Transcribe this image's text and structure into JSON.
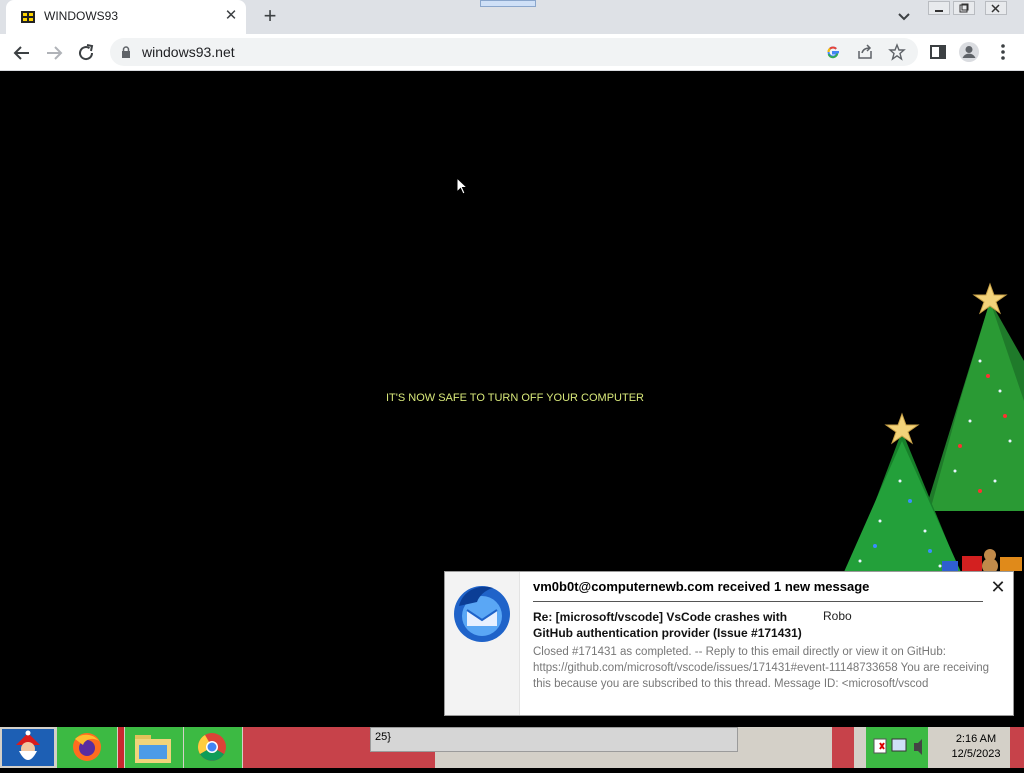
{
  "browser": {
    "tab_title": "WINDOWS93",
    "url": "windows93.net",
    "new_tab_symbol": "+",
    "close_symbol": "✕"
  },
  "page": {
    "message": "IT'S NOW SAFE TO TURN OFF YOUR COMPUTER"
  },
  "notification": {
    "title": "vm0b0t@computernewb.com received 1 new message",
    "subject": "Re: [microsoft/vscode] VsCode crashes with GitHub authentication provider (Issue #171431)",
    "sender": "Robo",
    "body": "Closed #171431 as completed. -- Reply to this email directly or view it on GitHub: https://github.com/microsoft/vscode/issues/171431#event-11148733658 You are receiving this because you are subscribed to this thread. Message ID: <microsoft/vscod",
    "close_symbol": "✕"
  },
  "taskbar": {
    "field_text": "25}",
    "time": "2:16 AM",
    "date": "12/5/2023"
  }
}
